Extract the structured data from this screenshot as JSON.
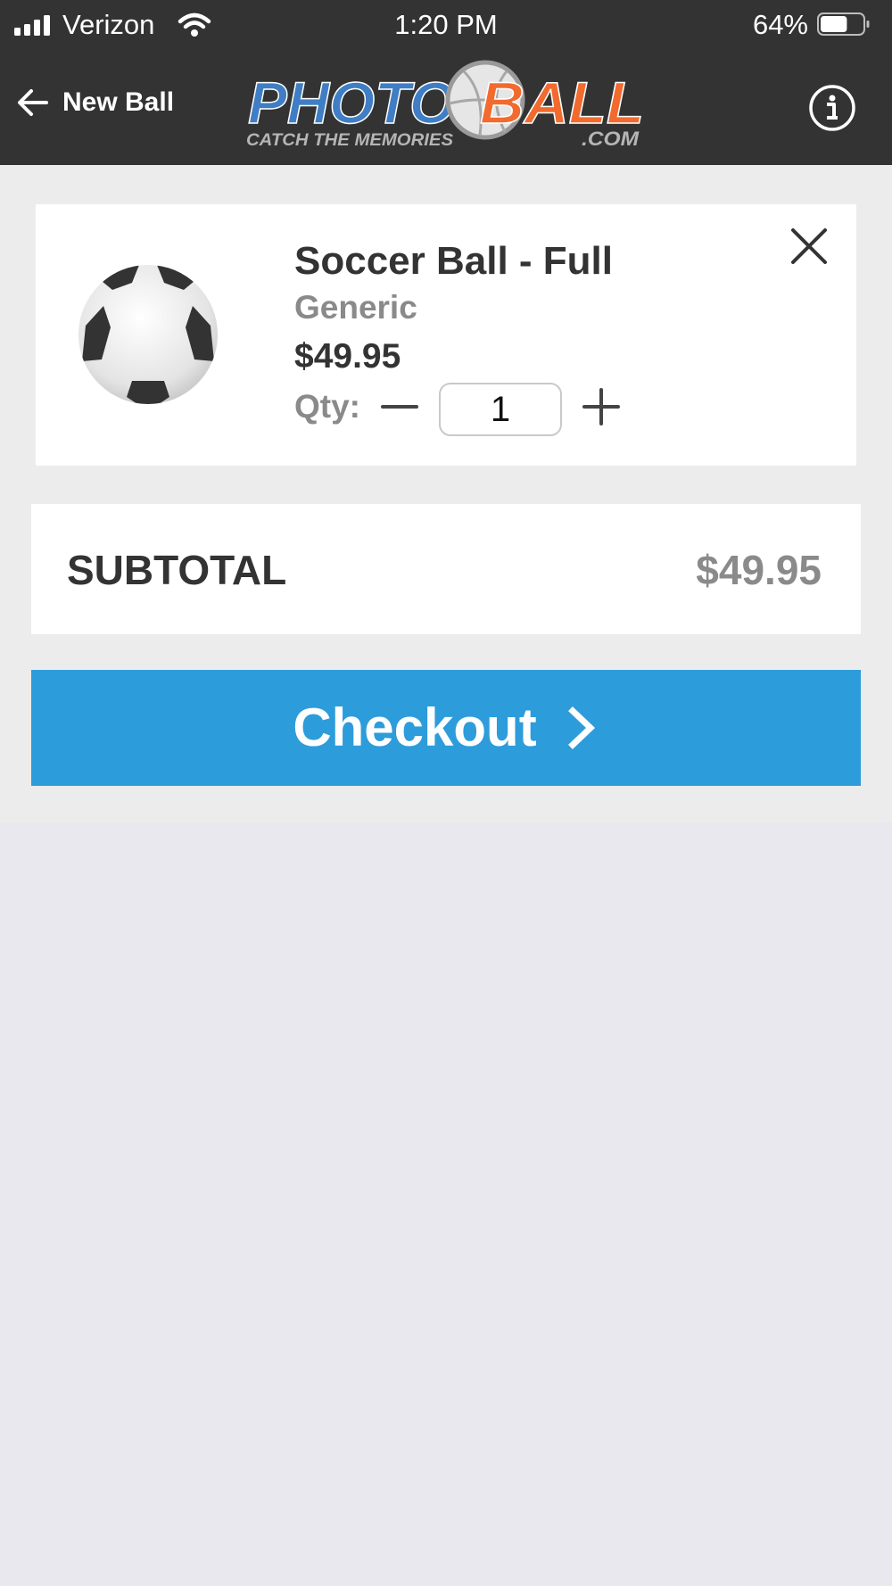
{
  "status_bar": {
    "carrier": "Verizon",
    "time": "1:20 PM",
    "battery_percent": "64%",
    "battery_level": 0.64,
    "signal_bars": 4
  },
  "nav": {
    "back_label": "New Ball",
    "back_icon": "arrow-left-icon",
    "info_icon": "info-icon",
    "logo": {
      "word1": "PHOTO",
      "word2": "BALL",
      "tagline": "CATCH THE MEMORIES",
      "suffix": ".COM"
    }
  },
  "cart": {
    "items": [
      {
        "name": "Soccer Ball - Full",
        "brand": "Generic",
        "price": "$49.95",
        "qty_label": "Qty:",
        "qty": "1",
        "image": "soccer-ball"
      }
    ],
    "subtotal_label": "SUBTOTAL",
    "subtotal_value": "$49.95",
    "checkout_label": "Checkout"
  },
  "colors": {
    "header_bg": "#333333",
    "accent_blue": "#2d9cdb",
    "logo_blue": "#3f7ec4",
    "logo_orange": "#f26a2e",
    "muted_text": "#8a8a8a",
    "page_bg": "#e9e8ee"
  }
}
